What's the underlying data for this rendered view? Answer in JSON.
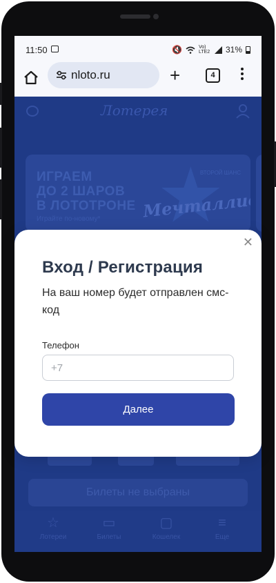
{
  "status_bar": {
    "time": "11:50",
    "network": "Vo) LTE2",
    "battery": "31%"
  },
  "browser": {
    "url": "nloto.ru",
    "tab_count": "4"
  },
  "site": {
    "logo_text": "Лотерея",
    "banner": {
      "headline_lines": [
        "ИГРАЕМ",
        "ДО 2 ШАРОВ",
        "В ЛОТОТРОНЕ"
      ],
      "subtext": "Играйте по-новому*",
      "tag": "ВТОРОЙ ШАНС",
      "brand": "Мечталлион"
    },
    "empty_tickets": "Билеты не выбраны",
    "bottom_nav": [
      {
        "label": "Лотереи",
        "icon": "star-icon"
      },
      {
        "label": "Билеты",
        "icon": "ticket-icon"
      },
      {
        "label": "Кошелек",
        "icon": "wallet-icon"
      },
      {
        "label": "Еще",
        "icon": "menu-icon"
      }
    ]
  },
  "modal": {
    "title": "Вход / Регистрация",
    "description": "На ваш номер будет отправлен смс-код",
    "phone_label": "Телефон",
    "phone_placeholder": "+7",
    "next_button": "Далее",
    "close_glyph": "✕"
  },
  "colors": {
    "overlay_blue": "#1f3a86",
    "primary_button": "#2f45a8",
    "title_text": "#2e3a4e"
  }
}
